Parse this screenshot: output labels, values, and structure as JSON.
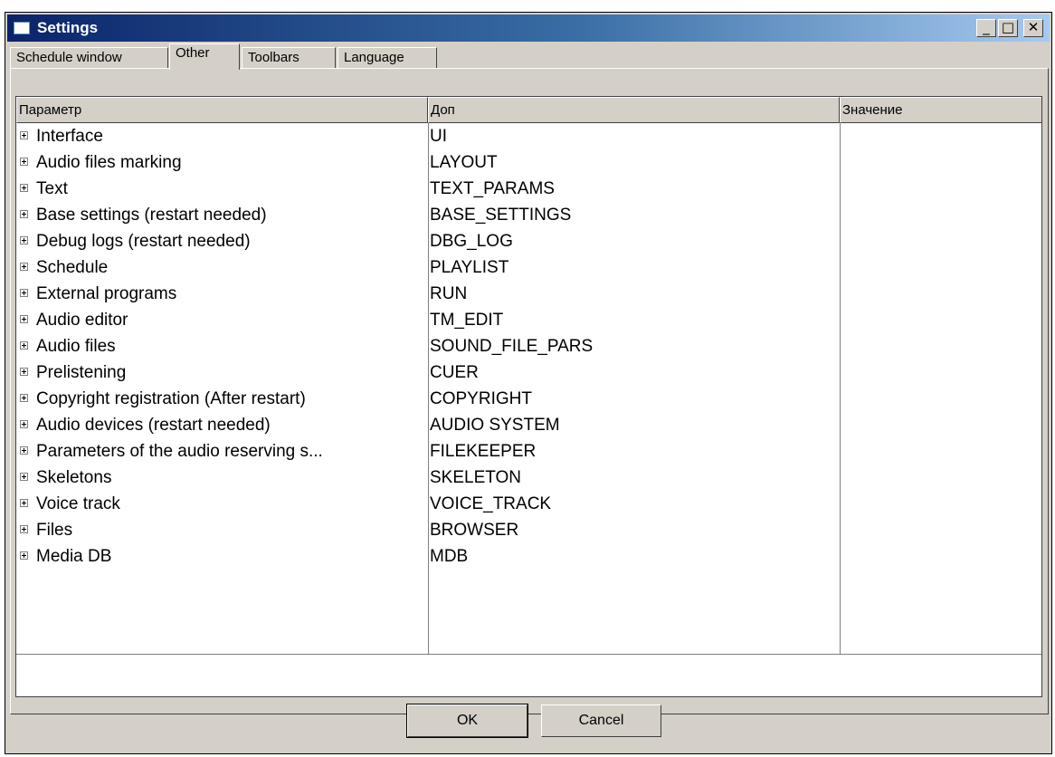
{
  "window": {
    "title": "Settings"
  },
  "titlebar_buttons": {
    "minimize": "_",
    "maximize": "□",
    "close": "✕"
  },
  "tabs": [
    {
      "label": "Schedule window",
      "active": false
    },
    {
      "label": "Other",
      "active": true
    },
    {
      "label": "Toolbars",
      "active": false
    },
    {
      "label": "Language",
      "active": false
    }
  ],
  "columns": [
    "Параметр",
    "Доп",
    "Значение"
  ],
  "rows": [
    {
      "param": "Interface",
      "dop": "UI",
      "value": ""
    },
    {
      "param": "Audio files marking",
      "dop": "LAYOUT",
      "value": ""
    },
    {
      "param": "Text",
      "dop": "TEXT_PARAMS",
      "value": ""
    },
    {
      "param": "Base settings (restart needed)",
      "dop": "BASE_SETTINGS",
      "value": ""
    },
    {
      "param": "Debug logs (restart needed)",
      "dop": "DBG_LOG",
      "value": ""
    },
    {
      "param": "Schedule",
      "dop": "PLAYLIST",
      "value": ""
    },
    {
      "param": "External programs",
      "dop": "RUN",
      "value": ""
    },
    {
      "param": "Audio editor",
      "dop": "TM_EDIT",
      "value": ""
    },
    {
      "param": "Audio files",
      "dop": "SOUND_FILE_PARS",
      "value": ""
    },
    {
      "param": "Prelistening",
      "dop": "CUER",
      "value": ""
    },
    {
      "param": "Copyright registration (After restart)",
      "dop": "COPYRIGHT",
      "value": ""
    },
    {
      "param": "Audio devices (restart needed)",
      "dop": "AUDIO SYSTEM",
      "value": ""
    },
    {
      "param": "Parameters of the audio reserving s...",
      "dop": "FILEKEEPER",
      "value": ""
    },
    {
      "param": "Skeletons",
      "dop": "SKELETON",
      "value": ""
    },
    {
      "param": "Voice track",
      "dop": "VOICE_TRACK",
      "value": ""
    },
    {
      "param": "Files",
      "dop": "BROWSER",
      "value": ""
    },
    {
      "param": "Media DB",
      "dop": "MDB",
      "value": ""
    }
  ],
  "buttons": {
    "ok": "OK",
    "cancel": "Cancel"
  }
}
